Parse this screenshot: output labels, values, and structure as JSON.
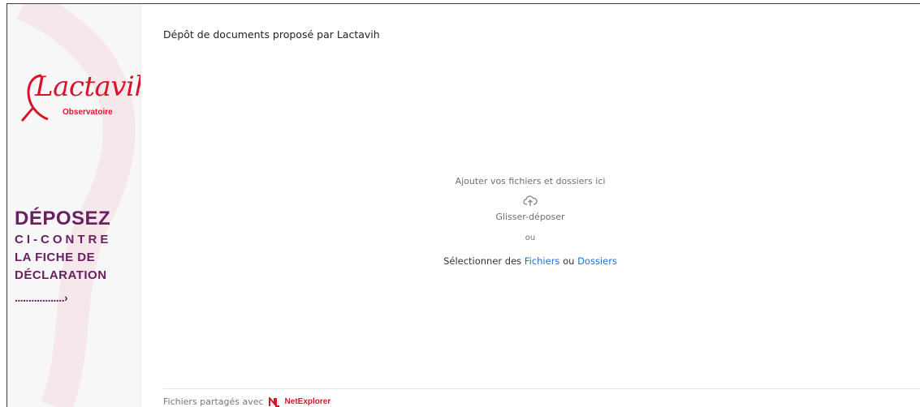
{
  "sidebar": {
    "logo": {
      "name": "Lactavih",
      "subtitle": "Observatoire"
    },
    "promo": {
      "line1": "DÉPOSEZ",
      "line2": "CI-CONTRE",
      "line3": "LA FICHE DE",
      "line4": "DÉCLARATION",
      "arrow": "..................›"
    }
  },
  "main": {
    "title": "Dépôt de documents proposé par Lactavih",
    "dropzone": {
      "heading": "Ajouter vos fichiers et dossiers ici",
      "icon": "cloud-upload-icon",
      "drag_label": "Glisser-déposer",
      "or_label": "ou",
      "select_prefix": "Sélectionner des",
      "files_link": "Fichiers",
      "connector": "ou",
      "folders_link": "Dossiers"
    }
  },
  "footer": {
    "shared_text": "Fichiers partagés avec",
    "brand": "NetExplorer",
    "brand_icon": "netexplorer-logo-icon"
  },
  "colors": {
    "brand_red": "#d8142b",
    "promo_purple": "#6a2060",
    "link_blue": "#1f6fd1"
  }
}
